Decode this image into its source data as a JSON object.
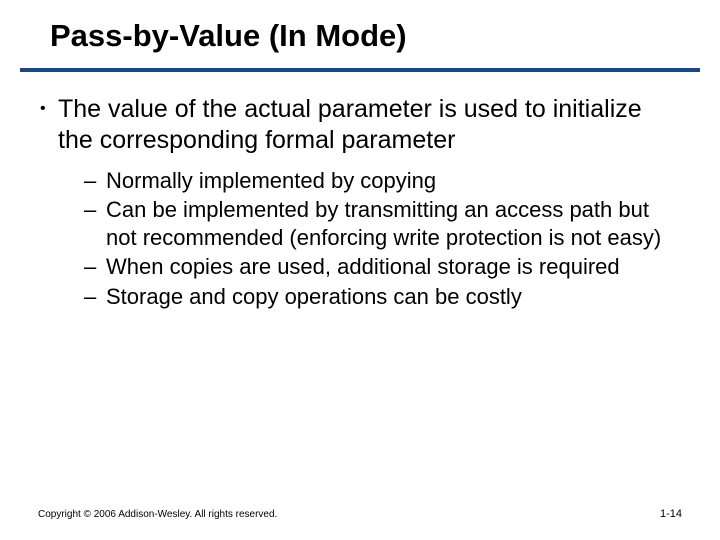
{
  "title": "Pass-by-Value (In Mode)",
  "main_bullet": "The value of the actual parameter is used to initialize the corresponding formal parameter",
  "sub_bullets": [
    "Normally implemented by copying",
    "Can be implemented by transmitting an access path but not recommended (enforcing write protection is not easy)",
    "When copies are used, additional storage is required",
    "Storage and copy operations can be costly"
  ],
  "footer": {
    "copyright": "Copyright © 2006 Addison-Wesley. All rights reserved.",
    "page": "1-14"
  },
  "glyphs": {
    "bullet": "•",
    "dash": "–"
  },
  "colors": {
    "rule": "#184a80"
  }
}
